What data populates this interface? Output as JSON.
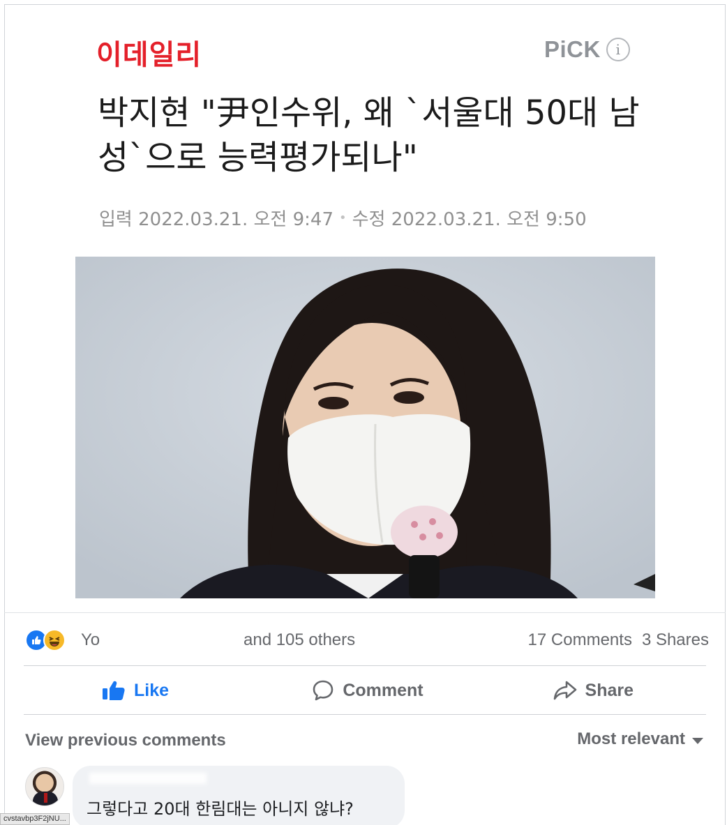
{
  "article": {
    "brand": "이데일리",
    "pick_label": "PiCK",
    "pick_info_icon": "info-circle-icon",
    "headline": "박지현 \"尹인수위, 왜 `서울대 50대 남성`으로 능력평가되나\"",
    "meta": {
      "input": "입력 2022.03.21. 오전 9:47",
      "modified": "수정 2022.03.21. 오전 9:50"
    },
    "photo_icon": "news-photo-icon"
  },
  "reactions": {
    "icons": [
      "like-icon",
      "haha-icon"
    ],
    "names_prefix": "Yo",
    "others": "and 105 others",
    "comments": "17 Comments",
    "shares": "3 Shares"
  },
  "actions": {
    "like": "Like",
    "comment": "Comment",
    "share": "Share"
  },
  "comments_section": {
    "view_previous": "View previous comments",
    "sort": "Most relevant",
    "items": [
      {
        "text": "그렇다고 20대 한림대는 아니지 않냐?"
      }
    ]
  },
  "status_bar": {
    "url": "cvstavbp3F2jNU..."
  },
  "colors": {
    "brand_red": "#e4202a",
    "facebook_blue": "#1877f2",
    "muted": "#65676b"
  }
}
